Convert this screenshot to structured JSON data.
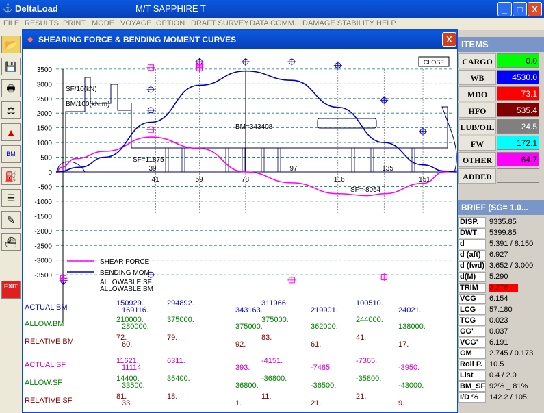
{
  "window": {
    "title": "DeltaLoad",
    "subtitle": "M/T SAPPHIRE T",
    "buttons": {
      "minimize": "_",
      "maximize": "□",
      "close": "X"
    }
  },
  "menu": [
    "FILE",
    "RESULTS",
    "PRINT",
    "MODE",
    "VOYAGE",
    "OPTION",
    "DRAFT SURVEY",
    "DATA COMM.",
    "DAMAGE STABILITY",
    "HELP"
  ],
  "toolbar": {
    "exit_label": "EXIT"
  },
  "items": {
    "header": "ITEMS",
    "rows": [
      {
        "label": "CARGO",
        "value": "0.0",
        "color": "#00ff00",
        "text_color": "#000000"
      },
      {
        "label": "WB",
        "value": "4530.0",
        "color": "#0000ff",
        "text_color": "#ffffff"
      },
      {
        "label": "MDO",
        "value": "73.1",
        "color": "#ff0000",
        "text_color": "#ffffff"
      },
      {
        "label": "HFO",
        "value": "535.4",
        "color": "#800000",
        "text_color": "#ffffff"
      },
      {
        "label": "LUB/OIL",
        "value": "24.5",
        "color": "#808080",
        "text_color": "#ffffff"
      },
      {
        "label": "FW",
        "value": "172.1",
        "color": "#00ffff",
        "text_color": "#000000"
      },
      {
        "label": "OTHER",
        "value": "64.7",
        "color": "#ff00ff",
        "text_color": "#000000"
      },
      {
        "label": "ADDED",
        "value": "",
        "color": "#d4d0c8",
        "text_color": "#000000"
      }
    ]
  },
  "brief": {
    "header": "BRIEF  (SG= 1.0...",
    "rows": [
      {
        "label": "DISP.",
        "value": "9335.85"
      },
      {
        "label": "DWT",
        "value": "5399.85"
      },
      {
        "label": "d",
        "value": "5.391   / 8.150"
      },
      {
        "label": "d (aft)",
        "value": "6.927"
      },
      {
        "label": "d (fwd)",
        "value": "3.652   / 3.000"
      },
      {
        "label": "d(M)",
        "value": "5.290"
      },
      {
        "label": "TRIM",
        "value": "3.276",
        "highlight": "#ff0000"
      },
      {
        "label": "VCG",
        "value": "6.154"
      },
      {
        "label": "LCG",
        "value": "57.180"
      },
      {
        "label": "TCG",
        "value": "0.023"
      },
      {
        "label": "GG'",
        "value": "0.037"
      },
      {
        "label": "VCG'",
        "value": "6.191"
      },
      {
        "label": "GM",
        "value": "2.745   / 0.173"
      },
      {
        "label": "Roll P.",
        "value": "10.5"
      },
      {
        "label": "List",
        "value": "0.4     / 2.0"
      },
      {
        "label": "BM_SF",
        "value": "92% _ 81%"
      },
      {
        "label": "I/D %",
        "value": "142.2   / 105"
      }
    ]
  },
  "dialog": {
    "title": "SHEARING FORCE & BENDING MOMENT CURVES",
    "close_label": "X",
    "chart_close_label": "CLOSE"
  },
  "chart_data": {
    "type": "line",
    "y_ticks": [
      3500,
      3000,
      2500,
      2000,
      1500,
      1000,
      500,
      0,
      -500,
      -1000,
      -1500,
      -2000,
      -2500,
      -3000,
      -3500
    ],
    "ylim": [
      -3600,
      3700
    ],
    "frames": [
      39,
      41,
      59,
      78,
      97,
      116,
      135,
      151
    ],
    "frame_labels_top": [
      39,
      97,
      135
    ],
    "frame_labels_bottom": [
      41,
      59,
      78,
      116,
      151
    ],
    "ylabel_sf": "SF/10(kN)",
    "ylabel_bm": "BM/100(kN.m)",
    "annotations": {
      "bm_max": "BM=343408",
      "sf_max": "SF=11875",
      "sf_min": "SF=-8054"
    },
    "series": [
      {
        "name": "SHEAR FORCE",
        "color": "#ff00ff",
        "x": [
          0,
          2,
          8,
          20,
          39,
          59,
          78,
          97,
          116,
          128,
          135,
          151,
          160,
          165
        ],
        "y": [
          0,
          150,
          450,
          700,
          1187,
          800,
          0,
          -370,
          -740,
          -805,
          -740,
          -390,
          0,
          40
        ]
      },
      {
        "name": "BENDING MOM",
        "color": "#0000cc",
        "x": [
          0,
          10,
          20,
          39,
          59,
          78,
          97,
          116,
          135,
          151,
          160,
          165
        ],
        "y": [
          0,
          160,
          500,
          1690,
          2950,
          3434,
          3120,
          2200,
          1000,
          240,
          30,
          0
        ]
      }
    ],
    "legend": [
      "SHEAR FORCE",
      "BENDING MOM",
      "ALLOWABLE SF",
      "ALLOWABLE BM"
    ],
    "allowable_bm_markers": [
      {
        "x": 39,
        "y": 2800
      },
      {
        "x": 39,
        "y": 2100
      },
      {
        "x": 59,
        "y": 3750
      },
      {
        "x": 78,
        "y": 3750
      },
      {
        "x": 97,
        "y": 3750
      },
      {
        "x": 116,
        "y": 3620
      },
      {
        "x": 135,
        "y": 2440
      },
      {
        "x": 151,
        "y": 1380
      },
      {
        "x": 39,
        "y": -3500
      },
      {
        "x": 3,
        "y": -3700
      }
    ],
    "allowable_sf_markers": [
      {
        "x": 39,
        "y": 3550
      },
      {
        "x": 39,
        "y": 1440
      },
      {
        "x": 59,
        "y": 3540
      },
      {
        "x": 59,
        "y": 3660
      },
      {
        "x": 97,
        "y": -3680
      },
      {
        "x": 135,
        "y": -3580
      },
      {
        "x": 3,
        "y": -3620
      }
    ]
  },
  "table": {
    "rows": [
      {
        "label": "ACTUAL BM",
        "color": "#0000cc",
        "values": [
          [
            "150929.",
            "169116."
          ],
          [
            "294892.",
            ""
          ],
          [
            "",
            "343163."
          ],
          [
            "311966.",
            ""
          ],
          [
            "",
            "219901."
          ],
          [
            "100510.",
            ""
          ],
          [
            "",
            "24021."
          ]
        ]
      },
      {
        "label": "ALLOW.BM",
        "color": "#008000",
        "values": [
          [
            "210000.",
            "280000."
          ],
          [
            "375000.",
            ""
          ],
          [
            "",
            "375000."
          ],
          [
            "375000.",
            ""
          ],
          [
            "",
            "362000."
          ],
          [
            "244000.",
            ""
          ],
          [
            "",
            "138000."
          ]
        ]
      },
      {
        "label": "RELATIVE BM",
        "color": "#800000",
        "values": [
          [
            "72.",
            "60."
          ],
          [
            "79.",
            ""
          ],
          [
            "",
            "92."
          ],
          [
            "83.",
            ""
          ],
          [
            "",
            "61."
          ],
          [
            "41.",
            ""
          ],
          [
            "",
            "17."
          ]
        ]
      },
      {
        "label": "ACTUAL SF",
        "color": "#cc00cc",
        "values": [
          [
            "11621.",
            "11114."
          ],
          [
            "6311.",
            ""
          ],
          [
            "",
            "393."
          ],
          [
            "-4151.",
            ""
          ],
          [
            "",
            "-7485."
          ],
          [
            "-7365.",
            ""
          ],
          [
            "",
            "-3950."
          ]
        ]
      },
      {
        "label": "ALLOW.SF",
        "color": "#008000",
        "values": [
          [
            "14400.",
            "33500."
          ],
          [
            "35400.",
            ""
          ],
          [
            "",
            "36800."
          ],
          [
            "-36800.",
            ""
          ],
          [
            "",
            "-36500."
          ],
          [
            "-35800.",
            ""
          ],
          [
            "",
            "-43000."
          ]
        ]
      },
      {
        "label": "RELATIVE SF",
        "color": "#800000",
        "values": [
          [
            "81.",
            "33."
          ],
          [
            "18.",
            ""
          ],
          [
            "",
            "1."
          ],
          [
            "11.",
            ""
          ],
          [
            "",
            "21."
          ],
          [
            "21.",
            ""
          ],
          [
            "",
            "9."
          ]
        ]
      }
    ]
  }
}
